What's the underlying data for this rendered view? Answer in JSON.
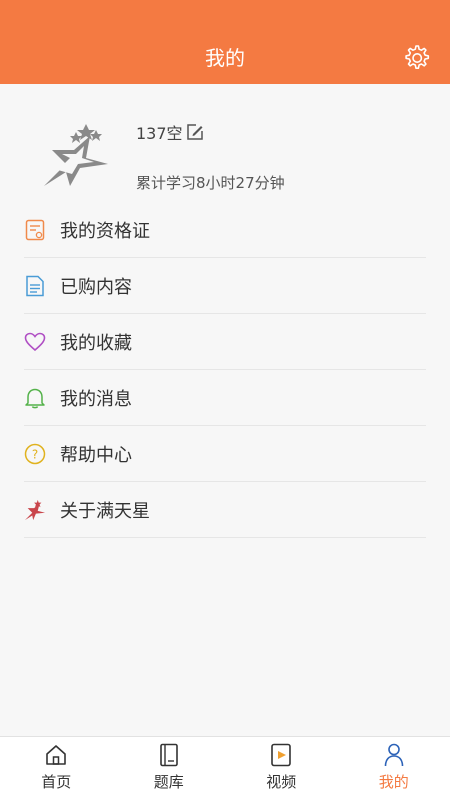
{
  "header": {
    "title": "我的"
  },
  "profile": {
    "username": "137空",
    "study_time": "累计学习8小时27分钟"
  },
  "menu": [
    {
      "label": "我的资格证",
      "icon": "certificate-icon",
      "color": "#f08a4b"
    },
    {
      "label": "已购内容",
      "icon": "purchased-document-icon",
      "color": "#4a9cd6"
    },
    {
      "label": "我的收藏",
      "icon": "heart-icon",
      "color": "#b04fc4"
    },
    {
      "label": "我的消息",
      "icon": "bell-icon",
      "color": "#54b24a"
    },
    {
      "label": "帮助中心",
      "icon": "help-question-icon",
      "color": "#e0b21e"
    },
    {
      "label": "关于满天星",
      "icon": "star-logo-icon",
      "color": "#c9454b"
    }
  ],
  "tabs": [
    {
      "label": "首页",
      "icon": "home-icon",
      "active": false
    },
    {
      "label": "题库",
      "icon": "question-bank-icon",
      "active": false
    },
    {
      "label": "视频",
      "icon": "video-icon",
      "active": false
    },
    {
      "label": "我的",
      "icon": "profile-icon",
      "active": true
    }
  ],
  "colors": {
    "accent": "#f47a42",
    "background": "#f7f7f7"
  }
}
